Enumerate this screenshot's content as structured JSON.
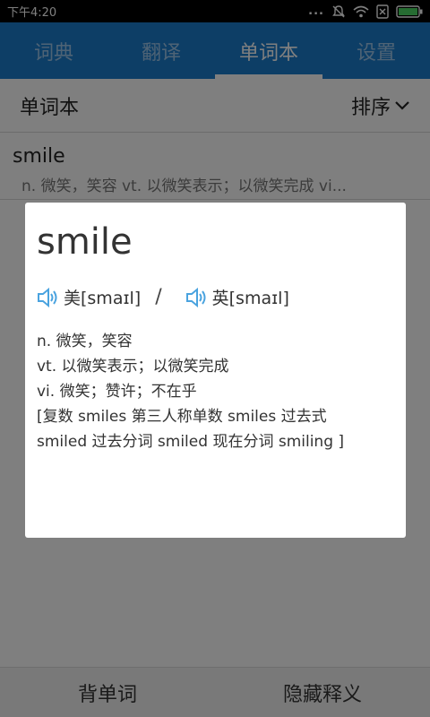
{
  "status_bar": {
    "time": "下午4:20",
    "dots": "..."
  },
  "tabs": [
    {
      "label": "词典",
      "active": false
    },
    {
      "label": "翻译",
      "active": false
    },
    {
      "label": "单词本",
      "active": true
    },
    {
      "label": "设置",
      "active": false
    }
  ],
  "header": {
    "title": "单词本",
    "sort_label": "排序"
  },
  "list": [
    {
      "word": "smile",
      "snippet": "n. 微笑，笑容 vt. 以微笑表示；以微笑完成 vi..."
    }
  ],
  "bottom_bar": {
    "recite_label": "背单词",
    "hide_label": "隐藏释义"
  },
  "dialog": {
    "word": "smile",
    "phonetic_us": "美[smaɪl]",
    "separator": "/",
    "phonetic_uk": "英[smaɪl]",
    "definitions": [
      "n. 微笑，笑容",
      "vt. 以微笑表示；以微笑完成",
      "vi. 微笑；赞许；不在乎",
      "[复数 smiles 第三人称单数 smiles 过去式",
      "smiled 过去分词 smiled 现在分词 smiling ]"
    ]
  },
  "colors": {
    "tab_bar": "#1a7ccc",
    "speaker_icon": "#4aa3df"
  }
}
